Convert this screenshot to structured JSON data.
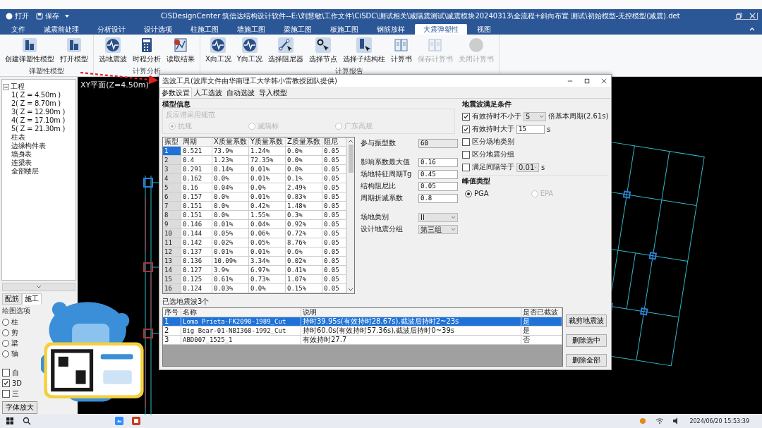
{
  "title_bar": {
    "quick_actions": [
      "打开",
      "保存"
    ],
    "title": "CiSDesignCenter 筑信达结构设计软件--E:\\刘慧敏\\工作文件\\CiSDC\\测试相关\\减隔震测试\\减震模块20240313\\全流程+斜向布置 测试\\初始模型-无控模型(减震).det"
  },
  "menu_tabs": [
    {
      "label": "文件",
      "selected": false
    },
    {
      "label": "减震前处理",
      "selected": false
    },
    {
      "label": "分析设计",
      "selected": false
    },
    {
      "label": "设计选项",
      "selected": false
    },
    {
      "label": "柱施工图",
      "selected": false
    },
    {
      "label": "墙施工图",
      "selected": false
    },
    {
      "label": "梁施工图",
      "selected": false
    },
    {
      "label": "板施工图",
      "selected": false
    },
    {
      "label": "钢筋放样",
      "selected": false
    },
    {
      "label": "大震弹塑性",
      "selected": true
    },
    {
      "label": "视图",
      "selected": false
    }
  ],
  "ribbon": [
    {
      "caption": "弹塑性模型",
      "buttons": [
        {
          "label": "创建弹塑性模型",
          "disabled": false
        },
        {
          "label": "打开模型",
          "disabled": false
        }
      ]
    },
    {
      "caption": "计算分析",
      "buttons": [
        {
          "label": "选地震波",
          "disabled": false
        },
        {
          "label": "时程分析",
          "disabled": false
        },
        {
          "label": "读取结果",
          "disabled": false
        }
      ]
    },
    {
      "caption": "计算报告",
      "buttons": [
        {
          "label": "X向工况",
          "disabled": false
        },
        {
          "label": "Y向工况",
          "disabled": false
        },
        {
          "label": "选择阻尼器",
          "disabled": false
        },
        {
          "label": "选择节点",
          "disabled": false
        },
        {
          "label": "选择子结构柱",
          "disabled": false
        },
        {
          "label": "计算书",
          "disabled": false
        },
        {
          "label": "保存计算书",
          "disabled": true
        },
        {
          "label": "关闭计算书",
          "disabled": true
        }
      ]
    }
  ],
  "tree": {
    "label": "工程",
    "expanded": true,
    "children": [
      {
        "label": "1( Z = 4.50m )"
      },
      {
        "label": "2( Z = 8.70m )"
      },
      {
        "label": "3( Z = 12.90m )"
      },
      {
        "label": "4( Z = 17.10m )"
      },
      {
        "label": "5( Z = 21.30m )"
      },
      {
        "label": "柱表"
      },
      {
        "label": "边缘构件表"
      },
      {
        "label": "墙身表"
      },
      {
        "label": "连梁表"
      },
      {
        "label": "全部楼层"
      }
    ]
  },
  "left_lower": {
    "tabs": [
      {
        "label": "配筋",
        "selected": false
      },
      {
        "label": "施工",
        "selected": true
      }
    ],
    "group_title": "绘图选项",
    "radios": [
      {
        "label": "柱",
        "selected": false
      },
      {
        "label": "剪",
        "selected": false
      },
      {
        "label": "梁",
        "selected": false
      },
      {
        "label": "轴",
        "selected": false
      }
    ],
    "checks": [
      {
        "label": "自",
        "checked": false
      },
      {
        "label": "3D",
        "checked": true
      },
      {
        "label": "三",
        "checked": false
      }
    ],
    "button": "字体放大"
  },
  "canvas": {
    "view_label": "XY平面(Z=4.50m)"
  },
  "dialog": {
    "title": "选波工具(波库文件由华南理工大学韩小雷教授团队提供)",
    "tabs": [
      {
        "label": "参数设置",
        "selected": true
      },
      {
        "label": "人工选波",
        "selected": false
      },
      {
        "label": "自动选波",
        "selected": false
      },
      {
        "label": "导入模型",
        "selected": false
      }
    ],
    "model_info": {
      "title": "模型信息",
      "disabled": true,
      "code_label": "反应谱采用规范",
      "options": [
        {
          "label": "抗规",
          "selected": true
        },
        {
          "label": "减隔标",
          "selected": false
        },
        {
          "label": "广东高规",
          "selected": false
        }
      ]
    },
    "modes_table": {
      "columns": [
        "振型",
        "周期",
        "X质量系数",
        "Y质量系数",
        "Z质量系数",
        "阻尼"
      ],
      "rows": [
        {
          "selected": true,
          "cells": [
            "1",
            "0.521",
            "73.9%",
            "1.24%",
            "0.0%",
            "0.05"
          ]
        },
        {
          "selected": false,
          "cells": [
            "2",
            "0.4",
            "1.23%",
            "72.35%",
            "0.0%",
            "0.05"
          ]
        },
        {
          "selected": false,
          "cells": [
            "3",
            "0.291",
            "0.14%",
            "0.01%",
            "0.0%",
            "0.05"
          ]
        },
        {
          "selected": false,
          "cells": [
            "4",
            "0.162",
            "0.0%",
            "0.01%",
            "0.1%",
            "0.05"
          ]
        },
        {
          "selected": false,
          "cells": [
            "5",
            "0.16",
            "0.04%",
            "0.0%",
            "2.49%",
            "0.05"
          ]
        },
        {
          "selected": false,
          "cells": [
            "6",
            "0.157",
            "0.0%",
            "0.01%",
            "0.83%",
            "0.05"
          ]
        },
        {
          "selected": false,
          "cells": [
            "7",
            "0.151",
            "0.0%",
            "0.42%",
            "1.48%",
            "0.05"
          ]
        },
        {
          "selected": false,
          "cells": [
            "8",
            "0.151",
            "0.0%",
            "1.55%",
            "0.3%",
            "0.05"
          ]
        },
        {
          "selected": false,
          "cells": [
            "9",
            "0.146",
            "0.01%",
            "0.04%",
            "0.92%",
            "0.05"
          ]
        },
        {
          "selected": false,
          "cells": [
            "10",
            "0.144",
            "0.05%",
            "0.06%",
            "0.72%",
            "0.05"
          ]
        },
        {
          "selected": false,
          "cells": [
            "11",
            "0.142",
            "0.02%",
            "0.05%",
            "8.76%",
            "0.05"
          ]
        },
        {
          "selected": false,
          "cells": [
            "12",
            "0.137",
            "0.01%",
            "0.01%",
            "0.6%",
            "0.05"
          ]
        },
        {
          "selected": false,
          "cells": [
            "13",
            "0.136",
            "10.09%",
            "3.34%",
            "0.02%",
            "0.05"
          ]
        },
        {
          "selected": false,
          "cells": [
            "14",
            "0.127",
            "3.9%",
            "6.97%",
            "0.41%",
            "0.05"
          ]
        },
        {
          "selected": false,
          "cells": [
            "15",
            "0.125",
            "0.61%",
            "0.73%",
            "1.07%",
            "0.05"
          ]
        },
        {
          "selected": false,
          "cells": [
            "16",
            "0.124",
            "0.03%",
            "0.0%",
            "0.15%",
            "0.05"
          ]
        }
      ]
    },
    "params": [
      {
        "kind": "readonly",
        "label": "参与振型数",
        "value": "60"
      },
      {
        "kind": "input",
        "label": "影响系数最大值",
        "value": "0.16"
      },
      {
        "kind": "input",
        "label": "场地特征周期Tg",
        "value": "0.45"
      },
      {
        "kind": "input",
        "label": "结构阻尼比",
        "value": "0.05"
      },
      {
        "kind": "input",
        "label": "周期折减系数",
        "value": "0.8"
      },
      {
        "kind": "dropdown",
        "label": "场地类别",
        "value": "II"
      },
      {
        "kind": "dropdown",
        "label": "设计地震分组",
        "value": "第三组"
      }
    ],
    "conditions": {
      "title": "地震波满足条件",
      "items": [
        {
          "label": "有效持时不小于",
          "checked": true,
          "control": {
            "kind": "dropdown",
            "value": "5"
          },
          "suffix": "倍基本周期(2.61s)"
        },
        {
          "label": "有效持时大于",
          "checked": true,
          "control": {
            "kind": "input",
            "value": "15"
          },
          "suffix": "s"
        },
        {
          "label": "区分场地类别",
          "checked": false
        },
        {
          "label": "区分地震分组",
          "checked": false
        },
        {
          "label": "满足间隔等于",
          "checked": false,
          "control": {
            "kind": "dropdown",
            "value": "0.01"
          },
          "suffix": "s"
        }
      ]
    },
    "peak_type": {
      "title": "峰值类型",
      "options": [
        {
          "label": "PGA",
          "selected": true,
          "disabled": false
        },
        {
          "label": "EPA",
          "selected": false,
          "disabled": true
        }
      ]
    },
    "selected_waves": {
      "title": "已选地震波3个",
      "columns": [
        "序号",
        "名称",
        "说明",
        "是否已截波"
      ],
      "rows": [
        {
          "selected": true,
          "cells": [
            "1",
            "Loma Prieta-FK2090-1989_Cut",
            "持时39.95s(有效持时28.67s),截波后持时2~23s",
            "是"
          ]
        },
        {
          "selected": false,
          "cells": [
            "2",
            "Big Bear-01-NBI360-1992_Cut",
            "持时60.0s(有效持时57.36s),截波后持时0~39s",
            "是"
          ]
        },
        {
          "selected": false,
          "cells": [
            "3",
            "ABD007_1525_1",
            "有效持时27.7",
            "否"
          ]
        }
      ]
    },
    "buttons": [
      "裁剪地震波",
      "删除选中",
      "删除全部"
    ]
  },
  "taskbar": {
    "clock": "2024/06/20 15:53:39"
  }
}
